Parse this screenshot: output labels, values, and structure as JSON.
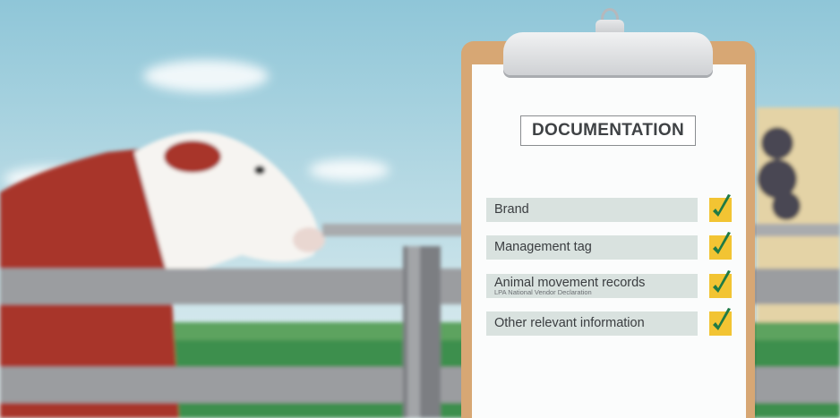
{
  "clipboard": {
    "title": "DOCUMENTATION",
    "items": [
      {
        "label": "Brand",
        "sub": "",
        "checked": true
      },
      {
        "label": "Management tag",
        "sub": "",
        "checked": true
      },
      {
        "label": "Animal movement records",
        "sub": "LPA National Vendor Declaration",
        "checked": true
      },
      {
        "label": "Other relevant information",
        "sub": "",
        "checked": true
      }
    ]
  },
  "colors": {
    "sky": "#bcdde7",
    "clipboard_board": "#d7a774",
    "item_background": "#d9e2df",
    "check_box": "#f2c433",
    "check_mark": "#1f7a45",
    "cow_red": "#a8362b"
  }
}
